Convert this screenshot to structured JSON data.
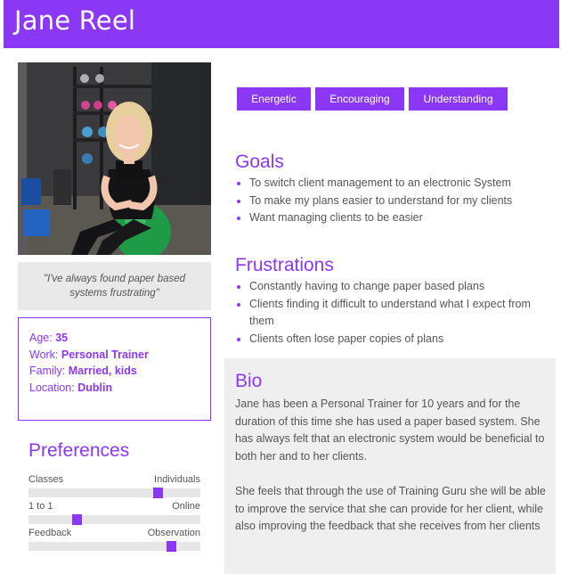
{
  "persona": {
    "name": "Jane Reel",
    "quote": "\"I've always found paper based systems frustrating\"",
    "traits": [
      "Energetic",
      "Encouraging",
      "Understanding"
    ],
    "colors": {
      "accent": "#8a38f5",
      "quote_bg": "#e9e9e9",
      "bio_bg": "#efefef"
    }
  },
  "info": {
    "age_label": "Age: ",
    "age": "35",
    "work_label": "Work: ",
    "work": "Personal Trainer",
    "family_label": "Family: ",
    "family": "Married, kids",
    "location_label": "Location: ",
    "location": "Dublin"
  },
  "preferences": {
    "title": "Preferences",
    "rows": [
      {
        "left": "Classes",
        "right": "Individuals",
        "level": 0.77
      },
      {
        "left": "1 to 1",
        "right": "Online",
        "level": 0.27
      },
      {
        "left": "Feedback",
        "right": "Observation",
        "level": 0.85
      }
    ]
  },
  "goals": {
    "title": "Goals",
    "items": [
      "To switch client management to an electronic System",
      "To make my plans easier to understand for my clients",
      "Want managing clients to be easier"
    ]
  },
  "frustrations": {
    "title": "Frustrations",
    "items": [
      "Constantly having to change paper based plans",
      "Clients finding it difficult to understand what I expect from them",
      "Clients often lose paper copies of plans"
    ]
  },
  "bio": {
    "title": "Bio",
    "p1": "Jane has been a Personal Trainer for 10 years and for the duration of this time she has used a paper based system. She has always felt that an electronic system would be beneficial to both her and to her clients.",
    "p2": "She feels that through the use of Training Guru she will be able to improve the service that she can provide for her client, while also improving the feedback that she receives from her clients"
  }
}
